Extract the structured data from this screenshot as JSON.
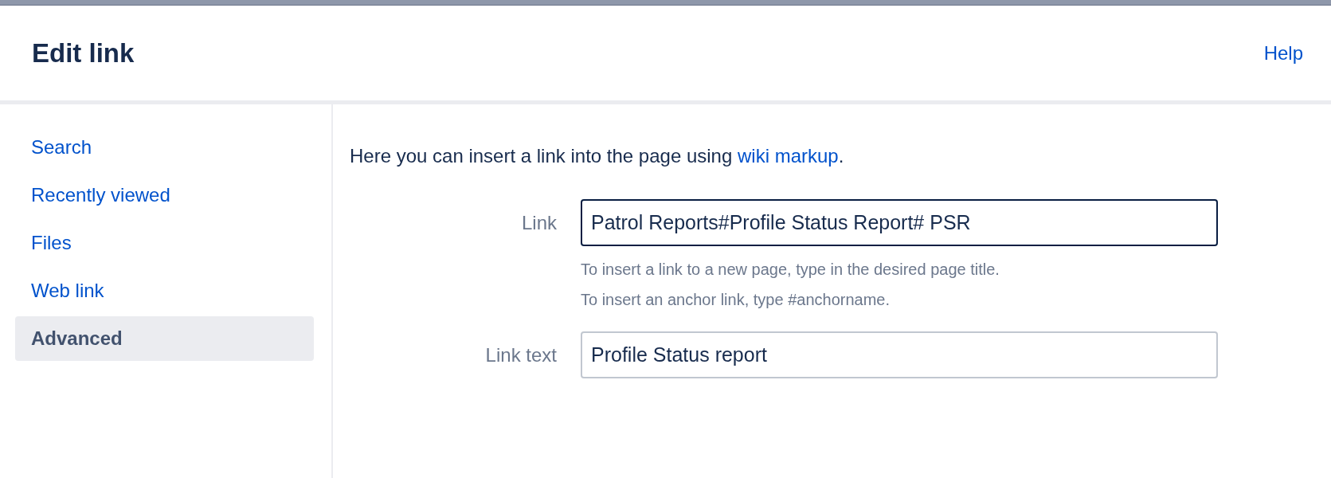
{
  "dialog": {
    "title": "Edit link",
    "help_link": "Help"
  },
  "sidebar": {
    "items": [
      {
        "label": "Search",
        "selected": false
      },
      {
        "label": "Recently viewed",
        "selected": false
      },
      {
        "label": "Files",
        "selected": false
      },
      {
        "label": "Web link",
        "selected": false
      },
      {
        "label": "Advanced",
        "selected": true
      }
    ]
  },
  "content": {
    "intro": "Here you can insert a link into the page using ",
    "intro_link": "wiki markup",
    "intro_end": ".",
    "fields": [
      {
        "label": "Link",
        "value": "Patrol Reports#Profile Status Report# PSR",
        "focused": true,
        "hints": [
          "To insert a link to a new page, type in the desired page title.",
          "To insert an anchor link, type #anchorname."
        ]
      },
      {
        "label": "Link text",
        "value": "Profile Status report",
        "focused": false
      }
    ]
  }
}
